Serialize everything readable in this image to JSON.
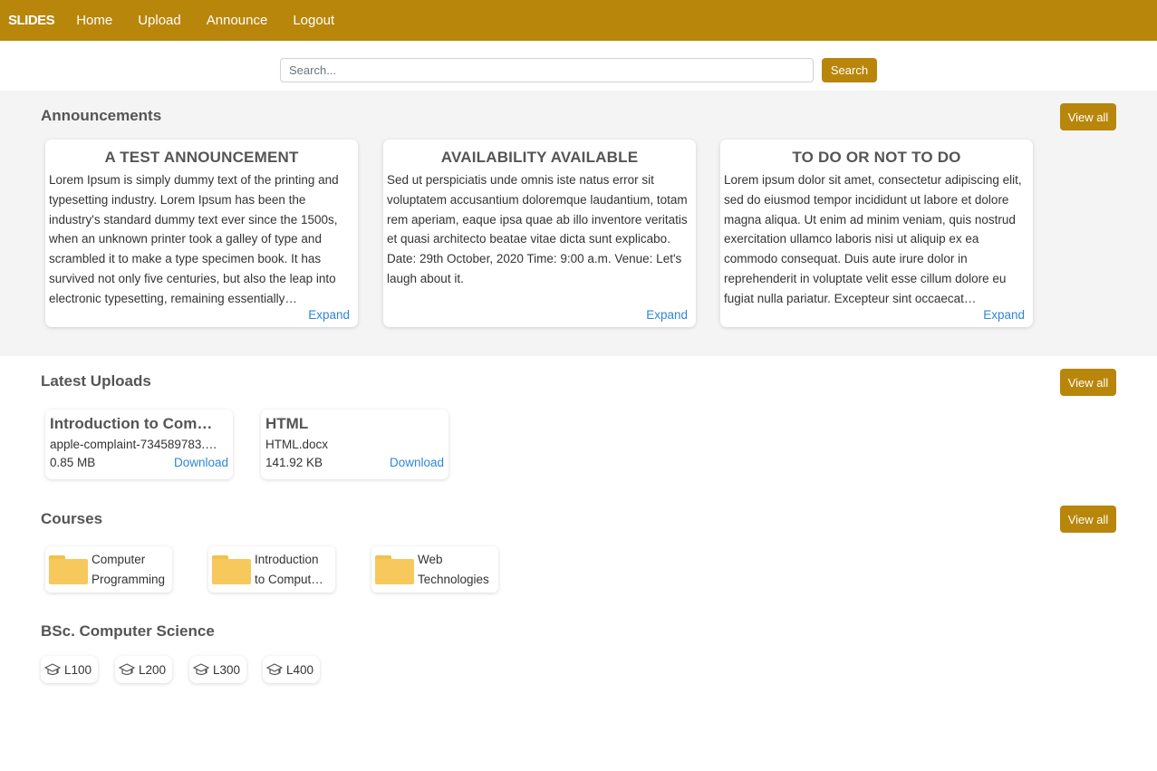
{
  "nav": {
    "brand": "SLIDES",
    "links": [
      "Home",
      "Upload",
      "Announce",
      "Logout"
    ]
  },
  "search": {
    "placeholder": "Search...",
    "button_label": "Search"
  },
  "announcements": {
    "title": "Announcements",
    "view_all": "View all",
    "expand_label": "Expand",
    "items": [
      {
        "title": "A TEST ANNOUNCEMENT",
        "body": "Lorem Ipsum is simply dummy text of the printing and typesetting industry. Lorem Ipsum has been the industry's standard dummy text ever since the 1500s, when an unknown printer took a galley of type and scrambled it to make a type specimen book. It has survived not only five centuries, but also the leap into electronic typesetting, remaining essentially…"
      },
      {
        "title": "AVAILABILITY AVAILABLE",
        "body": "Sed ut perspiciatis unde omnis iste natus error sit voluptatem accusantium doloremque laudantium, totam rem aperiam, eaque ipsa quae ab illo inventore veritatis et quasi architecto beatae vitae dicta sunt explicabo. Date: 29th October, 2020 Time: 9:00 a.m. Venue: Let's laugh about it."
      },
      {
        "title": "TO DO OR NOT TO DO",
        "body": "Lorem ipsum dolor sit amet, consectetur adipiscing elit, sed do eiusmod tempor incididunt ut labore et dolore magna aliqua. Ut enim ad minim veniam, quis nostrud exercitation ullamco laboris nisi ut aliquip ex ea commodo consequat. Duis aute irure dolor in reprehenderit in voluptate velit esse cillum dolore eu fugiat nulla pariatur. Excepteur sint occaecat…"
      }
    ]
  },
  "uploads": {
    "title": "Latest Uploads",
    "view_all": "View all",
    "download_label": "Download",
    "items": [
      {
        "title": "Introduction to Com…",
        "file": "apple-complaint-734589783.…",
        "size": "0.85 MB"
      },
      {
        "title": "HTML",
        "file": "HTML.docx",
        "size": "141.92 KB"
      }
    ]
  },
  "courses": {
    "title": "Courses",
    "view_all": "View all",
    "items": [
      {
        "line1": "Computer",
        "line2": "Programming"
      },
      {
        "line1": "Introduction",
        "line2": "to Comput…"
      },
      {
        "line1": "Web",
        "line2": "Technologies"
      }
    ]
  },
  "program": {
    "title": "BSc. Computer Science",
    "icon": "graduation-cap-icon",
    "levels": [
      "L100",
      "L200",
      "L300",
      "L400"
    ]
  },
  "colors": {
    "brand": "#b8860b",
    "link": "#2f86d6",
    "folder": "#f7c85c",
    "section_bg": "#f4f4f4"
  }
}
